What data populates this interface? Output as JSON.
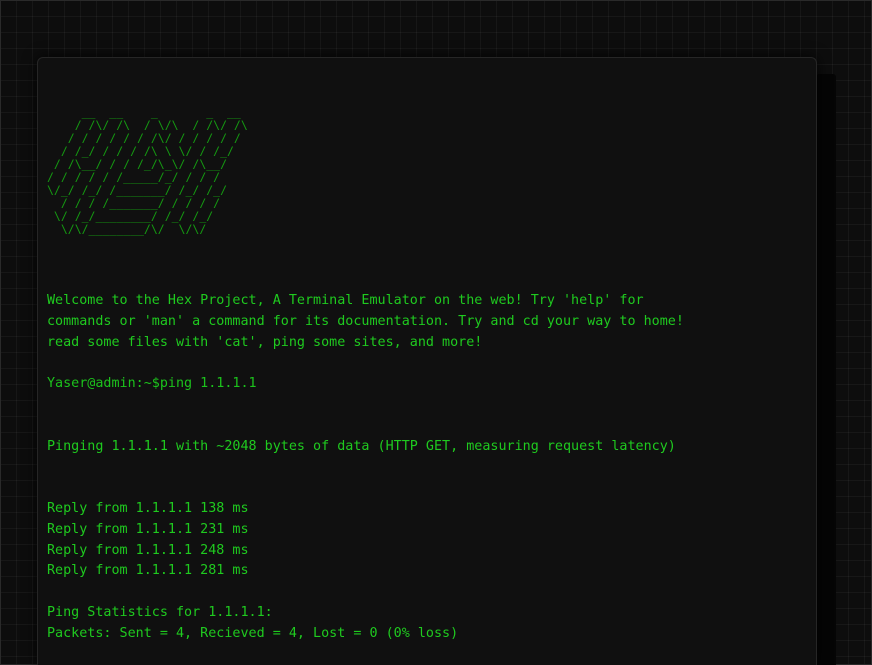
{
  "ascii_logo": "     __  __    _       _  __ \n    / /\\/ /\\  / \\/\\  / /\\/ /\\ \n   / / / / / / /\\/ / / / / / \n  / /_/ / / / /\\ \\ \\/ / /_/ \n / /\\__/ / / /_/\\_\\/ /\\__/ \n/ / / / / /_____/_/ / / / \n\\/_/ /_/ /_______/ /_/ /_/ \n  / / / /_______/ / / / / \n \\/ /_/________/ /_/ /_/ \n  \\/\\/________/\\/  \\/\\/ ",
  "lines": [
    "Welcome to the Hex Project, A Terminal Emulator on the web! Try 'help' for",
    "commands or 'man' a command for its documentation. Try and cd your way to home!",
    "read some files with 'cat', ping some sites, and more!",
    "",
    "Yaser@admin:~$ping 1.1.1.1",
    "",
    "",
    "Pinging 1.1.1.1 with ~2048 bytes of data (HTTP GET, measuring request latency)",
    "",
    "",
    "Reply from 1.1.1.1 138 ms",
    "Reply from 1.1.1.1 231 ms",
    "Reply from 1.1.1.1 248 ms",
    "Reply from 1.1.1.1 281 ms",
    "",
    "Ping Statistics for 1.1.1.1:",
    "Packets: Sent = 4, Recieved = 4, Lost = 0 (0% loss)"
  ],
  "colors": {
    "text": "#1fca1f",
    "logo": "#159a12",
    "terminal_bg": "#101010",
    "page_bg": "#0d0d0d"
  }
}
